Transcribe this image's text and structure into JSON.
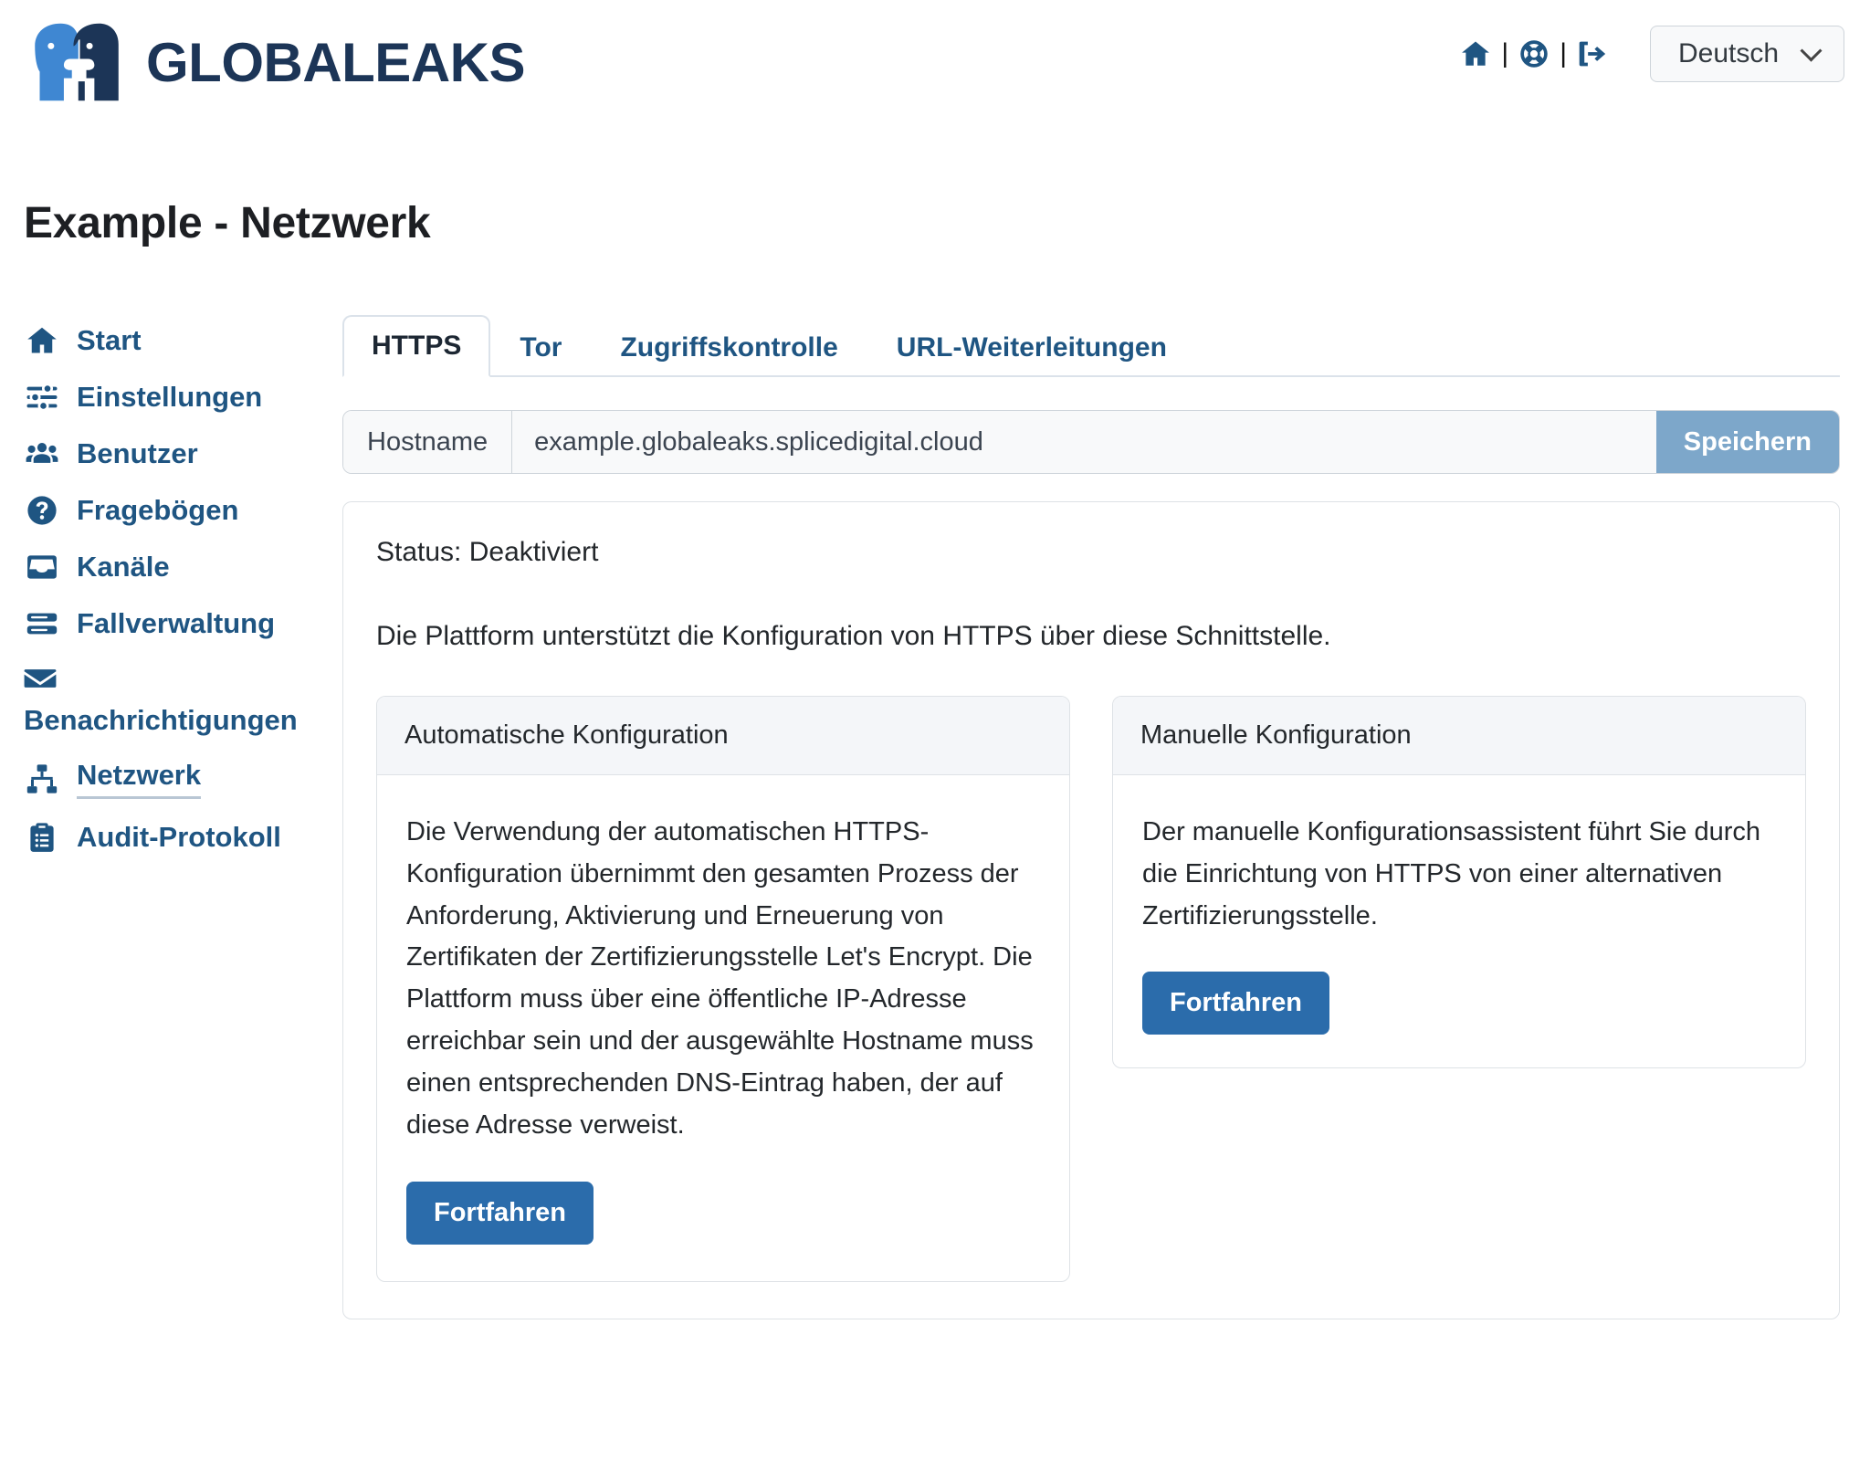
{
  "header": {
    "brand_name": "GLOBALEAKS",
    "brand_logo_icon": "globaleaks-two-faces-logo",
    "icons": [
      {
        "name": "home-icon",
        "label": "Start"
      },
      {
        "name": "lifebuoy-support-icon",
        "label": "Hilfe"
      },
      {
        "name": "sign-out-icon",
        "label": "Abmelden"
      }
    ],
    "separator": "|",
    "language": {
      "selected": "Deutsch",
      "options": [
        "Deutsch"
      ]
    }
  },
  "page_title": "Example - Netzwerk",
  "sidebar": {
    "items": [
      {
        "label": "Start",
        "icon": "home-icon",
        "active": false,
        "wrap": false
      },
      {
        "label": "Einstellungen",
        "icon": "sliders-icon",
        "active": false,
        "wrap": false
      },
      {
        "label": "Benutzer",
        "icon": "users-icon",
        "active": false,
        "wrap": false
      },
      {
        "label": "Fragebögen",
        "icon": "question-circle-icon",
        "active": false,
        "wrap": false
      },
      {
        "label": "Kanäle",
        "icon": "inbox-icon",
        "active": false,
        "wrap": false
      },
      {
        "label": "Fallverwaltung",
        "icon": "server-icon",
        "active": false,
        "wrap": false
      },
      {
        "label": "Benachrichtigungen",
        "icon": "envelope-icon",
        "active": false,
        "wrap": true
      },
      {
        "label": "Netzwerk",
        "icon": "network-sitemap-icon",
        "active": true,
        "wrap": false
      },
      {
        "label": "Audit-Protokoll",
        "icon": "clipboard-list-icon",
        "active": false,
        "wrap": false
      }
    ]
  },
  "tabs": [
    {
      "label": "HTTPS",
      "active": true
    },
    {
      "label": "Tor",
      "active": false
    },
    {
      "label": "Zugriffskontrolle",
      "active": false
    },
    {
      "label": "URL-Weiterleitungen",
      "active": false
    }
  ],
  "hostname_row": {
    "label": "Hostname",
    "value": "example.globaleaks.splicedigital.cloud",
    "placeholder": "",
    "save_label": "Speichern"
  },
  "https_panel": {
    "status": "Status: Deaktiviert",
    "intro": "Die Plattform unterstützt die Konfiguration von HTTPS über diese Schnittstelle.",
    "cards": [
      {
        "title": "Automatische Konfiguration",
        "body": "Die Verwendung der automatischen HTTPS-Konfiguration übernimmt den gesamten Prozess der Anforderung, Aktivierung und Erneuerung von Zertifikaten der Zertifizierungsstelle Let's Encrypt. Die Plattform muss über eine öffentliche IP-Adresse erreichbar sein und der ausgewählte Hostname muss einen entsprechenden DNS-Eintrag haben, der auf diese Adresse verweist.",
        "button_label": "Fortfahren"
      },
      {
        "title": "Manuelle Konfiguration",
        "body": "Der manuelle Konfigurationsassistent führt Sie durch die Einrichtung von HTTPS von einer alternativen Zertifizierungsstelle.",
        "button_label": "Fortfahren"
      }
    ]
  },
  "colors": {
    "brand_dark": "#1c3557",
    "brand_light_blue": "#3f87d2",
    "link_blue": "#1f5582",
    "primary_button": "#2b6cab",
    "disabled_button": "#7da7ca",
    "panel_border": "#dee2e6",
    "card_head_bg": "#f4f6f9",
    "input_bg": "#f8f9fa",
    "title_text": "#1d1f23"
  }
}
